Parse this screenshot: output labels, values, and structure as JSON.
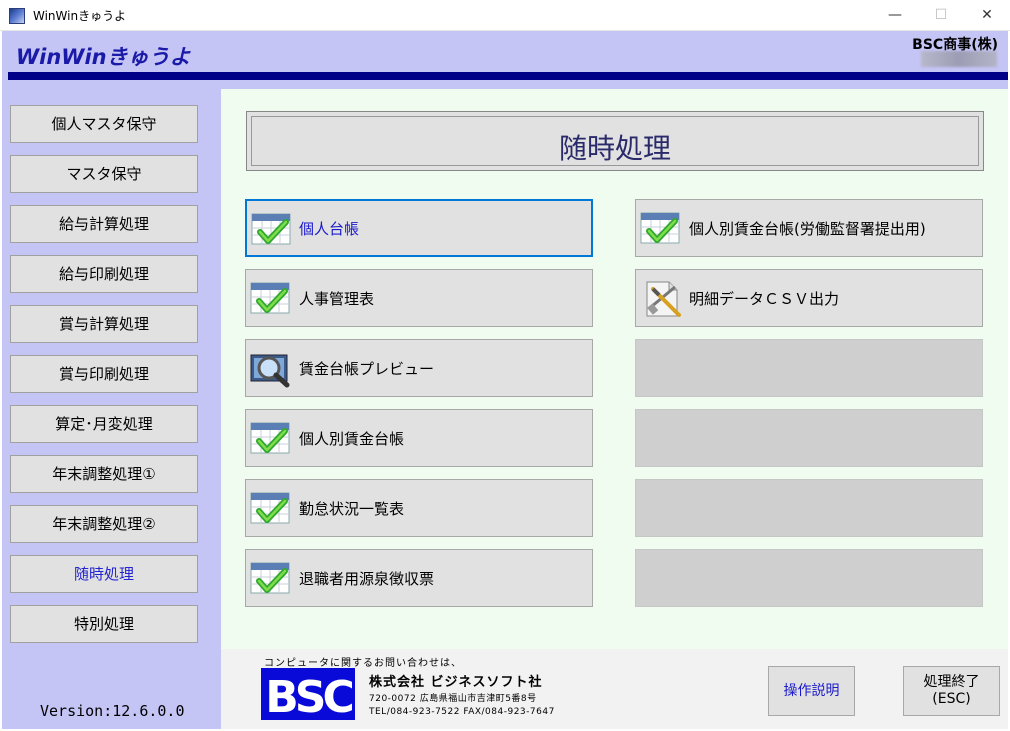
{
  "window": {
    "title": "WinWinきゅうよ",
    "minimize": "—",
    "maximize": "☐",
    "close": "✕"
  },
  "header": {
    "app_name": "WinWinきゅうよ",
    "company": "BSC商事(株)"
  },
  "sidebar": {
    "items": [
      {
        "label": "個人マスタ保守"
      },
      {
        "label": "マスタ保守"
      },
      {
        "label": "給与計算処理"
      },
      {
        "label": "給与印刷処理"
      },
      {
        "label": "賞与計算処理"
      },
      {
        "label": "賞与印刷処理"
      },
      {
        "label": "算定･月変処理"
      },
      {
        "label": "年末調整処理①"
      },
      {
        "label": "年末調整処理②"
      },
      {
        "label": "随時処理"
      },
      {
        "label": "特別処理"
      }
    ],
    "active_index": 9,
    "version": "Version:12.6.0.0"
  },
  "main": {
    "title": "随時処理",
    "left_buttons": [
      {
        "label": "個人台帳",
        "icon": "calendar-check-icon"
      },
      {
        "label": "人事管理表",
        "icon": "calendar-check-icon"
      },
      {
        "label": "賃金台帳プレビュー",
        "icon": "magnifier-preview-icon"
      },
      {
        "label": "個人別賃金台帳",
        "icon": "calendar-check-icon"
      },
      {
        "label": "勤怠状況一覧表",
        "icon": "calendar-check-icon"
      },
      {
        "label": "退職者用源泉徴収票",
        "icon": "calendar-check-icon"
      }
    ],
    "right_buttons": [
      {
        "label": "個人別賃金台帳(労働監督署提出用)",
        "icon": "calendar-check-icon"
      },
      {
        "label": "明細データＣＳＶ出力",
        "icon": "document-tools-icon"
      },
      {
        "label": ""
      },
      {
        "label": ""
      },
      {
        "label": ""
      },
      {
        "label": ""
      }
    ]
  },
  "footer": {
    "contact": "コンピュータに関するお問い合わせは、",
    "logo_text": "BSC",
    "corp": "株式会社 ビジネスソフト社",
    "address": "720-0072  広島県福山市吉津町5番8号",
    "tel": "TEL/084-923-7522  FAX/084-923-7647",
    "help_button": "操作説明",
    "quit_button_line1": "処理終了",
    "quit_button_line2": "(ESC)"
  },
  "colors": {
    "header_bg": "#c4c4f5",
    "header_bar": "#000088",
    "main_bg": "#f1fcf1",
    "button_bg": "#e1e1e1",
    "accent_text": "#1a1acc",
    "focus_border": "#0078d7"
  }
}
